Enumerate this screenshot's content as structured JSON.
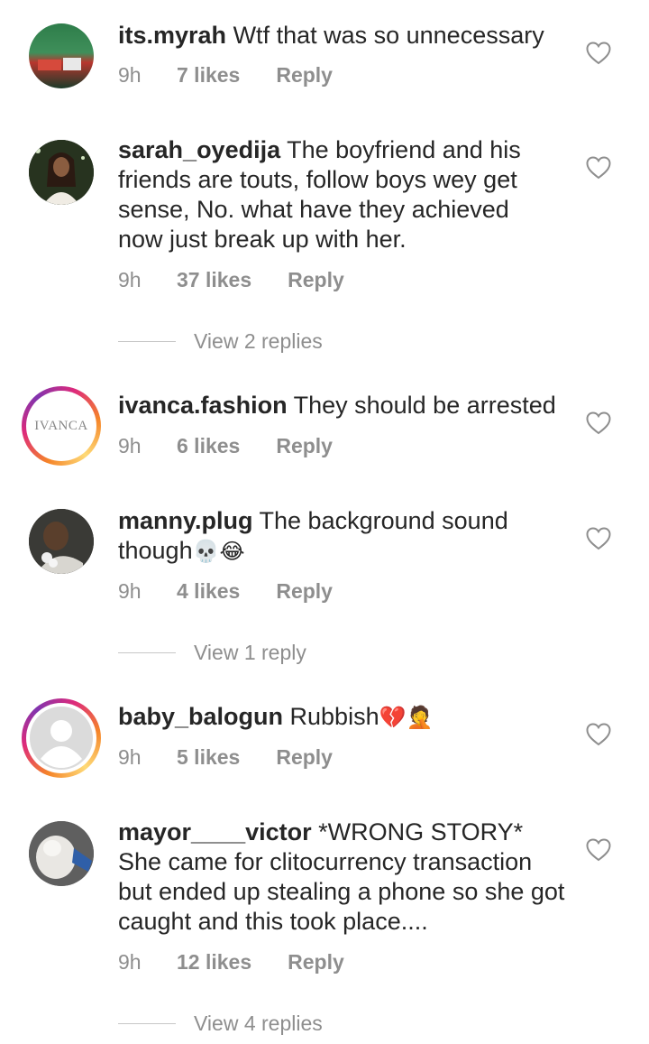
{
  "comments": [
    {
      "username": "its.myrah",
      "text": "Wtf that was so unnecessary",
      "time": "9h",
      "likes": "7 likes",
      "reply": "Reply"
    },
    {
      "username": "sarah_oyedija",
      "text": "The boyfriend and his friends are touts, follow boys wey get sense, No. what have they achieved now just break up with her.",
      "time": "9h",
      "likes": "37 likes",
      "reply": "Reply",
      "view_replies": "View 2 replies"
    },
    {
      "username": "ivanca.fashion",
      "text": "They should be arrested",
      "time": "9h",
      "likes": "6 likes",
      "reply": "Reply",
      "avatar_text": "IVANCA"
    },
    {
      "username": "manny.plug",
      "text": "The background sound though",
      "emoji": "💀😂",
      "time": "9h",
      "likes": "4 likes",
      "reply": "Reply",
      "view_replies": "View 1 reply"
    },
    {
      "username": "baby_balogun",
      "text": "Rubbish",
      "emoji": "💔🤦",
      "time": "9h",
      "likes": "5 likes",
      "reply": "Reply"
    },
    {
      "username": "mayor____victor",
      "text": "*WRONG STORY* She came for clitocurrency transaction but ended up stealing a phone so she got caught and this took place....",
      "time": "9h",
      "likes": "12 likes",
      "reply": "Reply",
      "view_replies": "View 4 replies"
    }
  ],
  "icons": {
    "like": "heart-outline-icon",
    "default_avatar": "person-silhouette-icon"
  },
  "colors": {
    "text": "#262626",
    "meta": "#8e8e8e",
    "ring_gradient": [
      "#f58529",
      "#dd2a7b",
      "#8134af",
      "#feda77"
    ]
  }
}
